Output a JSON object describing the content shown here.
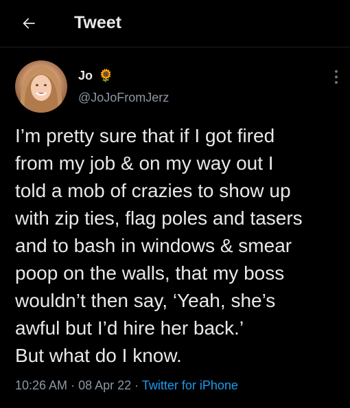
{
  "header": {
    "title": "Tweet",
    "back_icon": "arrow-left-icon"
  },
  "tweet": {
    "author": {
      "name": "Jo",
      "emoji": "🌻",
      "handle": "@JoJoFromJerz",
      "avatar": "profile-photo"
    },
    "more_icon": "vertical-ellipsis-icon",
    "text_lines": [
      "I’m pretty sure that if I got fired",
      "from my job & on my way out I",
      "told a mob of crazies to show up",
      "with zip ties, flag poles and tasers",
      "and to bash in windows & smear",
      "poop on the walls, that my boss",
      "wouldn’t then say, ‘Yeah, she’s",
      "awful but I’d hire her back.’",
      "But what do I know."
    ],
    "time": "10:26 AM",
    "separator": "·",
    "date": "08 Apr 22",
    "source": "Twitter for iPhone"
  },
  "colors": {
    "background": "#000000",
    "text": "#e7e9ea",
    "secondary_text": "#8b98a5",
    "link": "#1d9bf0"
  }
}
